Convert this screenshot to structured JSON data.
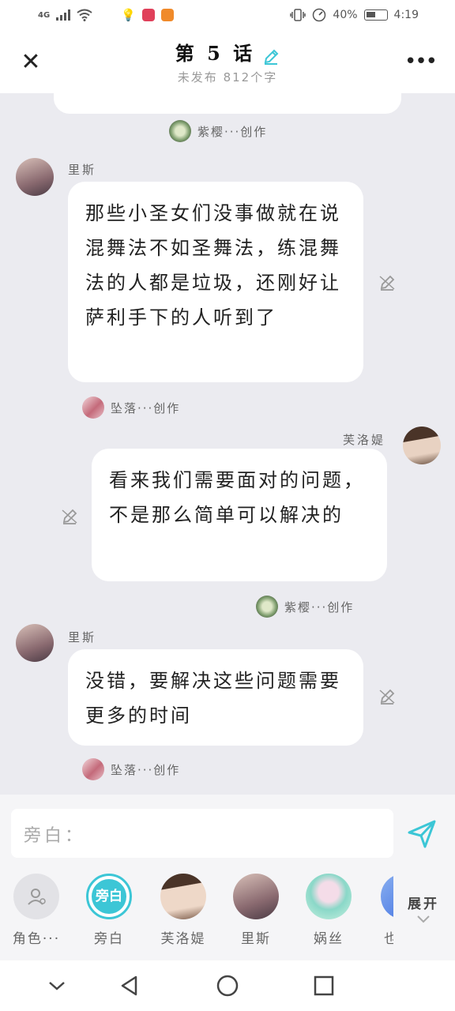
{
  "status": {
    "network": "4G",
    "battery_percent": "40%",
    "time": "4:19"
  },
  "header": {
    "title": "第 5 话",
    "subtitle": "未发布 812个字"
  },
  "messages": [
    {
      "side": "left",
      "speaker": "里斯",
      "text": "那些小圣女们没事做就在说混舞法不如圣舞法，练混舞法的人都是垃圾，还刚好让萨利手下的人听到了",
      "author": "坠落···创作"
    },
    {
      "side": "right",
      "speaker": "芙洛媞",
      "text": "看来我们需要面对的问题，不是那么简单可以解决的",
      "author": "紫樱···创作"
    },
    {
      "side": "left",
      "speaker": "里斯",
      "text": "没错，要解决这些问题需要更多的时间",
      "author": "坠落···创作"
    }
  ],
  "top_author": "紫樱···创作",
  "composer": {
    "placeholder": "旁白："
  },
  "roles": [
    {
      "label": "角色···"
    },
    {
      "label": "旁白",
      "ring_text": "旁白"
    },
    {
      "label": "芙洛媞"
    },
    {
      "label": "里斯"
    },
    {
      "label": "娲丝"
    },
    {
      "label": "也"
    }
  ],
  "expand_label": "展开",
  "colors": {
    "accent": "#3cc6d6",
    "bubble": "#ffffff",
    "background": "#ebebf0"
  }
}
